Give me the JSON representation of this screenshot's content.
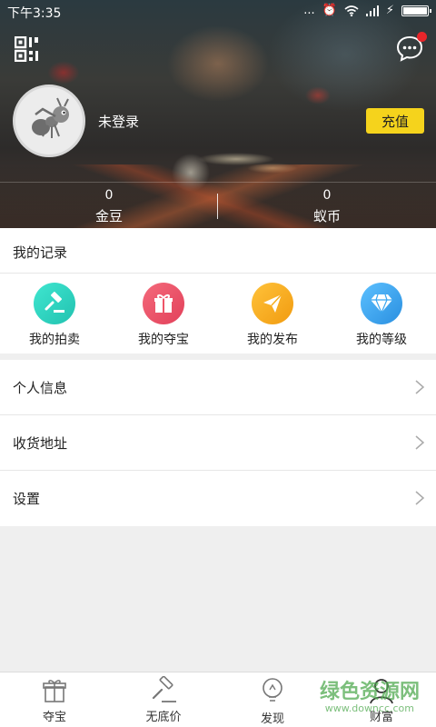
{
  "status_bar": {
    "time": "下午3:35",
    "signal_text": "..."
  },
  "profile": {
    "login_status": "未登录",
    "recharge_label": "充值"
  },
  "stats": [
    {
      "value": "0",
      "label": "金豆"
    },
    {
      "value": "0",
      "label": "蚁币"
    }
  ],
  "records": {
    "title": "我的记录",
    "items": [
      {
        "label": "我的拍卖",
        "icon": "gavel-icon",
        "color": "#2ed6c1"
      },
      {
        "label": "我的夺宝",
        "icon": "gift-icon",
        "color": "#ee5568"
      },
      {
        "label": "我的发布",
        "icon": "paper-plane-icon",
        "color": "#f6ad1d"
      },
      {
        "label": "我的等级",
        "icon": "diamond-icon",
        "color": "#39a6f0"
      }
    ]
  },
  "menu": [
    {
      "label": "个人信息"
    },
    {
      "label": "收货地址"
    },
    {
      "label": "设置"
    }
  ],
  "tabs": [
    {
      "label": "夺宝",
      "icon": "gift-icon"
    },
    {
      "label": "无底价",
      "icon": "gavel-icon"
    },
    {
      "label": "发现",
      "icon": "lightbulb-icon"
    },
    {
      "label": "财富",
      "icon": "person-icon"
    }
  ],
  "watermark": {
    "text": "绿色资源网",
    "url": "www.downcc.com"
  },
  "colors": {
    "accent_yellow": "#f5d31c",
    "notification_red": "#e8252a"
  }
}
